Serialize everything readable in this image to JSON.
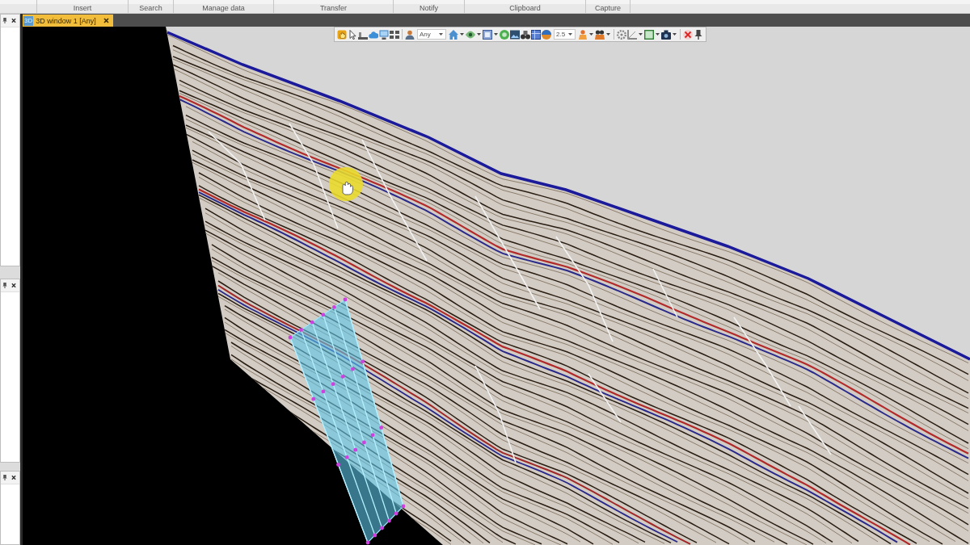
{
  "ribbon": {
    "groups": [
      {
        "label": "Insert"
      },
      {
        "label": "Search"
      },
      {
        "label": "Manage data"
      },
      {
        "label": "Transfer"
      },
      {
        "label": "Notify"
      },
      {
        "label": "Clipboard"
      },
      {
        "label": "Capture"
      }
    ]
  },
  "tabs": [
    {
      "badge": "3D",
      "label": "3D window 1 [Any]",
      "selected": true
    }
  ],
  "toolbar": {
    "dropdowns": [
      {
        "value": "Any"
      },
      {
        "value": "2.5"
      }
    ]
  }
}
